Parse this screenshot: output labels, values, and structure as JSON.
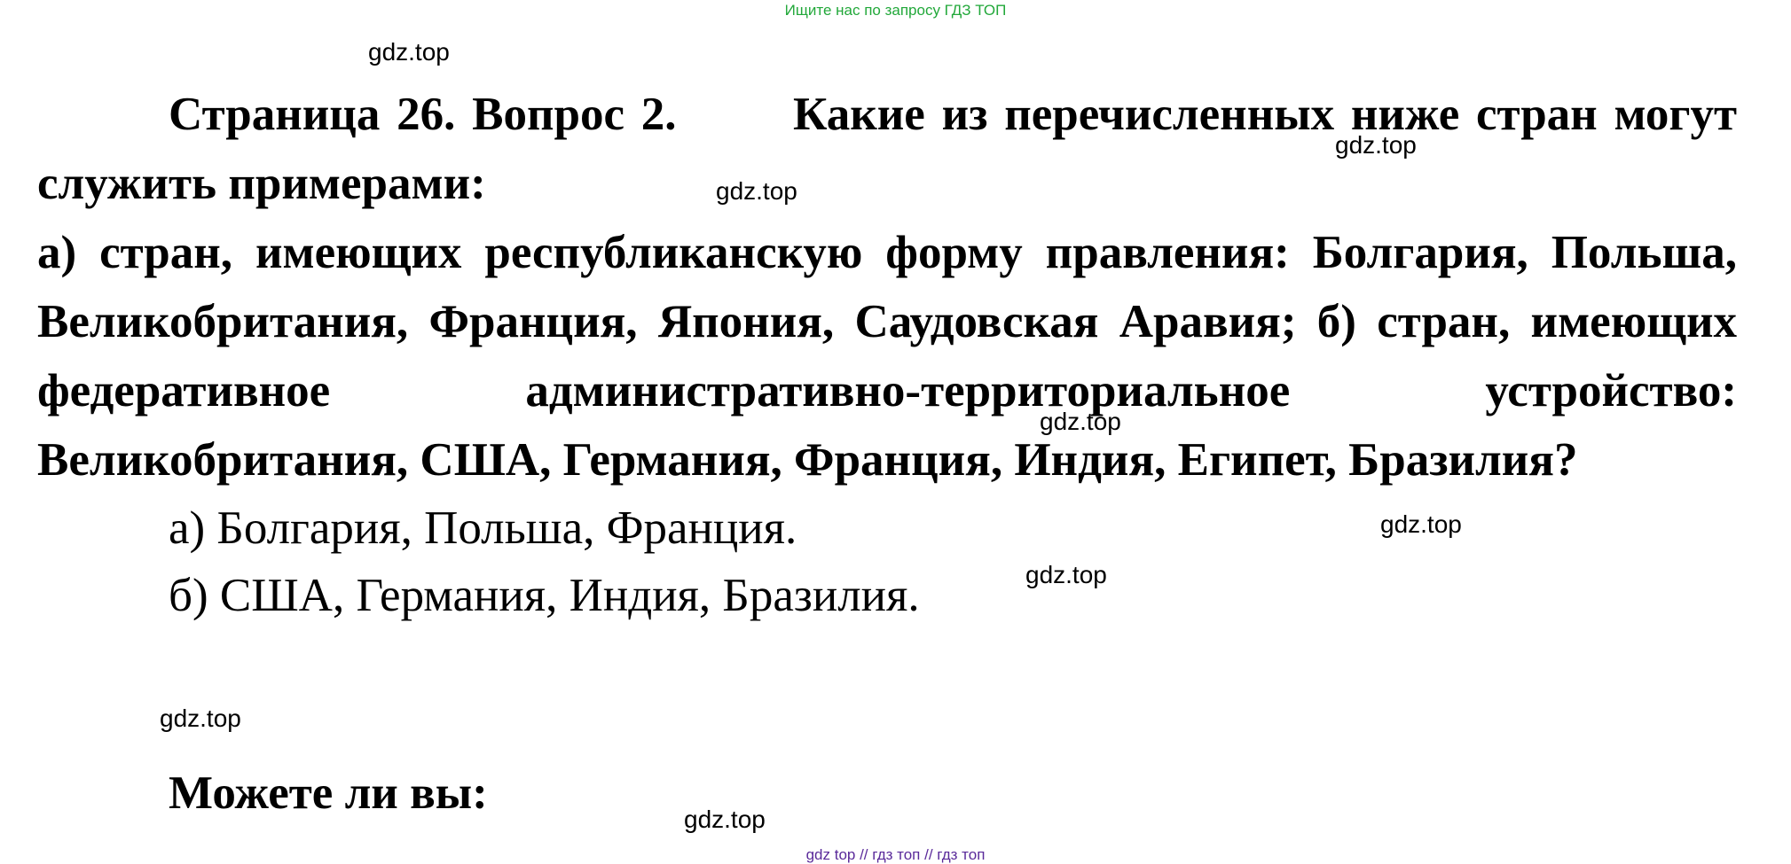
{
  "top_banner": "Ищите нас по запросу ГДЗ ТОП",
  "question": {
    "header": "Страница 26. Вопрос 2.",
    "intro": "Какие из перечисленных ниже стран могут служить примерами:",
    "body": "а) стран, имеющих республиканскую форму правления: Болгария, Польша, Великобритания, Франция, Япония, Саудовская Аравия; б) стран, имеющих федеративное административно-территориальное устройство: Великобритания, США, Германия, Франция, Индия, Египет, Бразилия?"
  },
  "answers": [
    "а) Болгария, Польша, Франция.",
    "б) США, Германия, Индия, Бразилия."
  ],
  "next_section": "Можете ли вы:",
  "watermarks": [
    "gdz.top",
    "gdz.top",
    "gdz.top",
    "gdz.top",
    "gdz.top",
    "gdz.top",
    "gdz.top",
    "gdz.top"
  ],
  "footer": "gdz top  //  гдз топ  //  гдз топ"
}
